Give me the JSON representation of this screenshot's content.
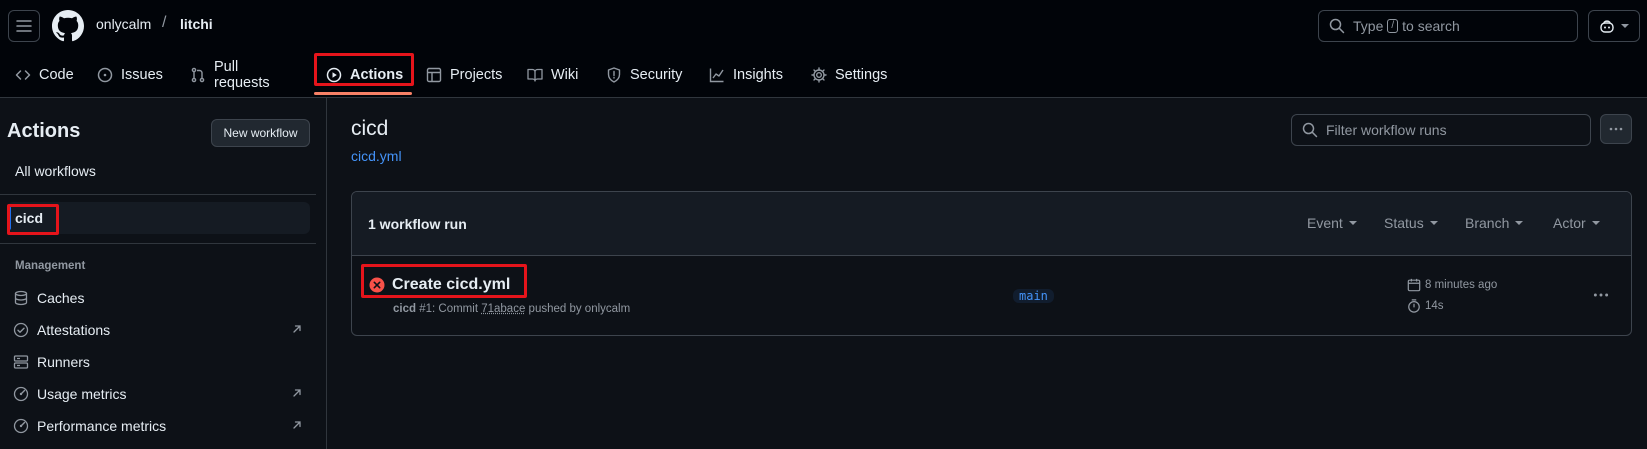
{
  "header": {
    "owner": "onlycalm",
    "separator": "/",
    "repo": "litchi",
    "search_prefix": "Type",
    "search_key": "/",
    "search_suffix": "to search"
  },
  "nav": {
    "items": [
      {
        "label": "Code",
        "icon": "code-icon"
      },
      {
        "label": "Issues",
        "icon": "issue-icon"
      },
      {
        "label": "Pull requests",
        "icon": "pull-request-icon"
      },
      {
        "label": "Actions",
        "icon": "play-icon",
        "active": true
      },
      {
        "label": "Projects",
        "icon": "table-icon"
      },
      {
        "label": "Wiki",
        "icon": "book-icon"
      },
      {
        "label": "Security",
        "icon": "shield-icon"
      },
      {
        "label": "Insights",
        "icon": "graph-icon"
      },
      {
        "label": "Settings",
        "icon": "gear-icon"
      }
    ]
  },
  "sidebar": {
    "title": "Actions",
    "new_workflow": "New workflow",
    "all_workflows": "All workflows",
    "selected_workflow": "cicd",
    "management_heading": "Management",
    "management_items": [
      {
        "label": "Caches",
        "icon": "database-icon"
      },
      {
        "label": "Attestations",
        "icon": "verified-icon",
        "external": true
      },
      {
        "label": "Runners",
        "icon": "server-icon"
      },
      {
        "label": "Usage metrics",
        "icon": "meter-icon",
        "external": true
      },
      {
        "label": "Performance metrics",
        "icon": "meter-icon",
        "external": true
      }
    ]
  },
  "main": {
    "title": "cicd",
    "file": "cicd.yml",
    "filter_placeholder": "Filter workflow runs",
    "runs_count": "1 workflow run",
    "filters": [
      "Event",
      "Status",
      "Branch",
      "Actor"
    ],
    "run": {
      "status": "failure",
      "title": "Create cicd.yml",
      "workflow": "cicd",
      "number": "#1",
      "sub_middle": ": Commit",
      "sha": "71abace",
      "pushed_by": "pushed by onlycalm",
      "branch": "main",
      "time": "8 minutes ago",
      "duration": "14s"
    }
  },
  "colors": {
    "background": "#0d1117",
    "header": "#010409",
    "link": "#4493f8",
    "failure": "#f85149",
    "highlight": "#e5141b"
  }
}
